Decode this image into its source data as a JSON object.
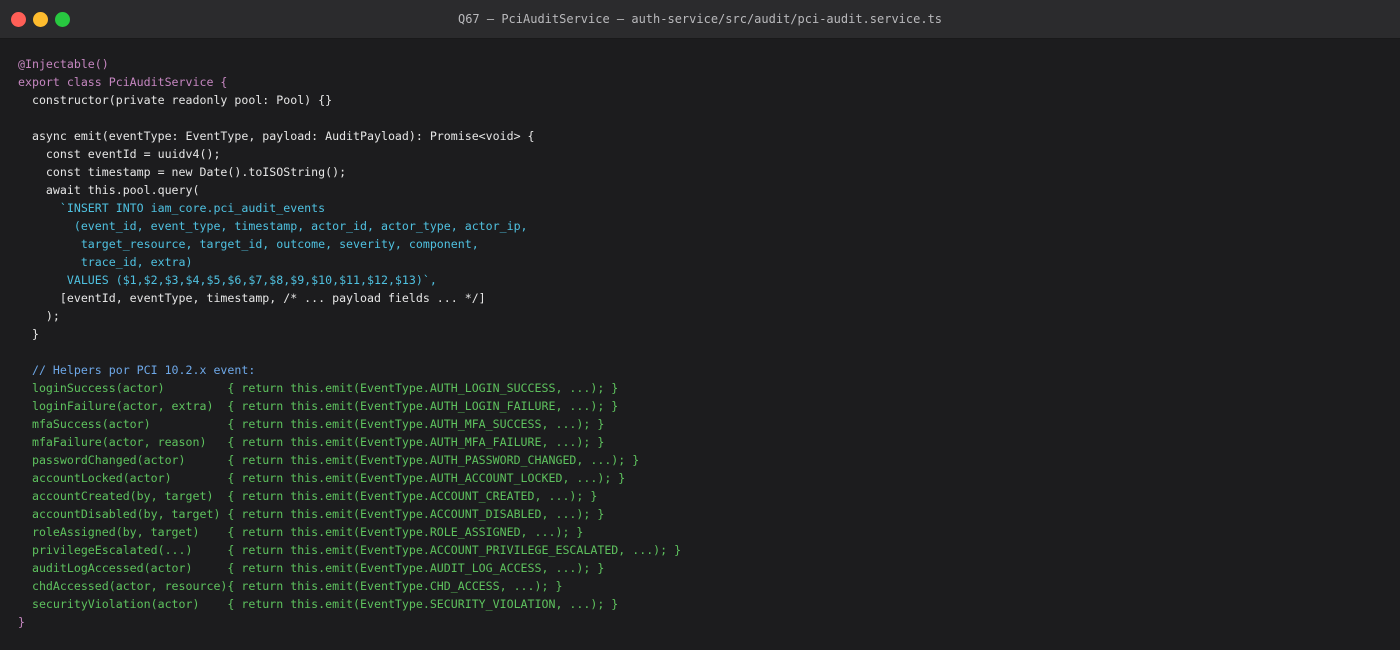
{
  "window": {
    "title": "Q67 — PciAuditService — auth-service/src/audit/pci-audit.service.ts"
  },
  "code": {
    "lines": [
      {
        "text": "@Injectable()",
        "color": "purple"
      },
      {
        "text": "export class PciAuditService {",
        "color": "purple"
      },
      {
        "text": "  constructor(private readonly pool: Pool) {}",
        "color": "white"
      },
      {
        "text": "",
        "color": "white"
      },
      {
        "text": "  async emit(eventType: EventType, payload: AuditPayload): Promise<void> {",
        "color": "white"
      },
      {
        "text": "    const eventId = uuidv4();",
        "color": "white"
      },
      {
        "text": "    const timestamp = new Date().toISOString();",
        "color": "white"
      },
      {
        "text": "    await this.pool.query(",
        "color": "white"
      },
      {
        "text": "      `INSERT INTO iam_core.pci_audit_events",
        "color": "cyan"
      },
      {
        "text": "        (event_id, event_type, timestamp, actor_id, actor_type, actor_ip,",
        "color": "cyan"
      },
      {
        "text": "         target_resource, target_id, outcome, severity, component,",
        "color": "cyan"
      },
      {
        "text": "         trace_id, extra)",
        "color": "cyan"
      },
      {
        "text": "       VALUES ($1,$2,$3,$4,$5,$6,$7,$8,$9,$10,$11,$12,$13)`,",
        "color": "cyan"
      },
      {
        "text": "      [eventId, eventType, timestamp, /* ... payload fields ... */]",
        "color": "white"
      },
      {
        "text": "    );",
        "color": "white"
      },
      {
        "text": "  }",
        "color": "white"
      },
      {
        "text": "",
        "color": "white"
      },
      {
        "text": "  // Helpers por PCI 10.2.x event:",
        "color": "comment"
      },
      {
        "text": "  loginSuccess(actor)         { return this.emit(EventType.AUTH_LOGIN_SUCCESS, ...); }",
        "color": "green"
      },
      {
        "text": "  loginFailure(actor, extra)  { return this.emit(EventType.AUTH_LOGIN_FAILURE, ...); }",
        "color": "green"
      },
      {
        "text": "  mfaSuccess(actor)           { return this.emit(EventType.AUTH_MFA_SUCCESS, ...); }",
        "color": "green"
      },
      {
        "text": "  mfaFailure(actor, reason)   { return this.emit(EventType.AUTH_MFA_FAILURE, ...); }",
        "color": "green"
      },
      {
        "text": "  passwordChanged(actor)      { return this.emit(EventType.AUTH_PASSWORD_CHANGED, ...); }",
        "color": "green"
      },
      {
        "text": "  accountLocked(actor)        { return this.emit(EventType.AUTH_ACCOUNT_LOCKED, ...); }",
        "color": "green"
      },
      {
        "text": "  accountCreated(by, target)  { return this.emit(EventType.ACCOUNT_CREATED, ...); }",
        "color": "green"
      },
      {
        "text": "  accountDisabled(by, target) { return this.emit(EventType.ACCOUNT_DISABLED, ...); }",
        "color": "green"
      },
      {
        "text": "  roleAssigned(by, target)    { return this.emit(EventType.ROLE_ASSIGNED, ...); }",
        "color": "green"
      },
      {
        "text": "  privilegeEscalated(...)     { return this.emit(EventType.ACCOUNT_PRIVILEGE_ESCALATED, ...); }",
        "color": "green"
      },
      {
        "text": "  auditLogAccessed(actor)     { return this.emit(EventType.AUDIT_LOG_ACCESS, ...); }",
        "color": "green"
      },
      {
        "text": "  chdAccessed(actor, resource){ return this.emit(EventType.CHD_ACCESS, ...); }",
        "color": "green"
      },
      {
        "text": "  securityViolation(actor)    { return this.emit(EventType.SECURITY_VIOLATION, ...); }",
        "color": "green"
      },
      {
        "text": "}",
        "color": "purple"
      }
    ]
  },
  "colors": {
    "background": "#1c1c1e",
    "titlebar": "#2b2b2d",
    "keyword": "#c586c0",
    "plain": "#e6e6e6",
    "string": "#4fc1e0",
    "comment": "#6ea8e8",
    "helpers": "#5ec25e"
  }
}
